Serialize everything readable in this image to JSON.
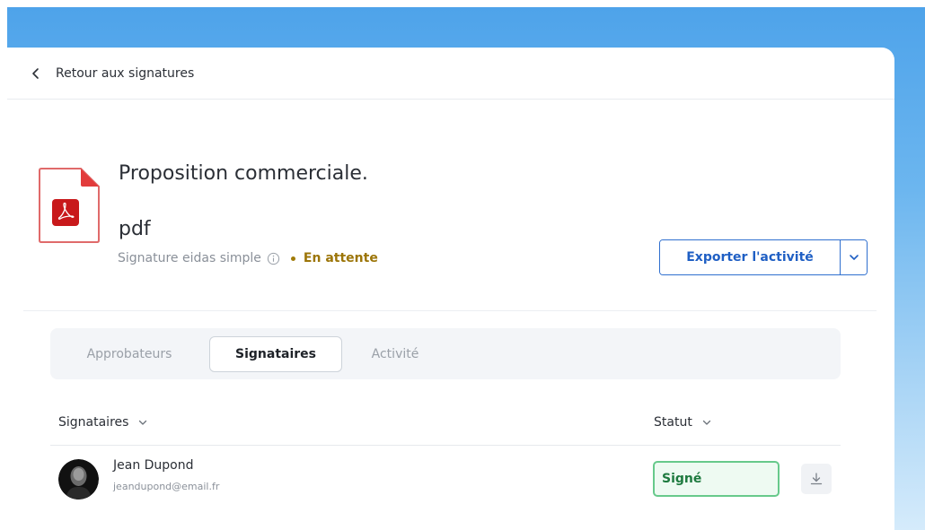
{
  "nav": {
    "back_label": "Retour aux signatures"
  },
  "document": {
    "title": "Proposition commerciale.\npdf",
    "signature_type": "Signature eidas simple",
    "status": "En attente"
  },
  "actions": {
    "export_label": "Exporter l'activité"
  },
  "tabs": [
    {
      "label": "Approbateurs",
      "active": false
    },
    {
      "label": "Signataires",
      "active": true
    },
    {
      "label": "Activité",
      "active": false
    }
  ],
  "table": {
    "columns": {
      "signers": "Signataires",
      "status": "Statut"
    },
    "rows": [
      {
        "name": "Jean Dupond",
        "email": "jeandupond@email.fr",
        "status": "Signé"
      }
    ]
  },
  "colors": {
    "accent": "#1f5fc4",
    "pending": "#9c7508",
    "signed": "#1e7a3f",
    "pdf_red": "#c8191b"
  },
  "icons": [
    "chevron-left-icon",
    "pdf-file-icon",
    "info-icon",
    "chevron-down-icon",
    "download-icon"
  ]
}
